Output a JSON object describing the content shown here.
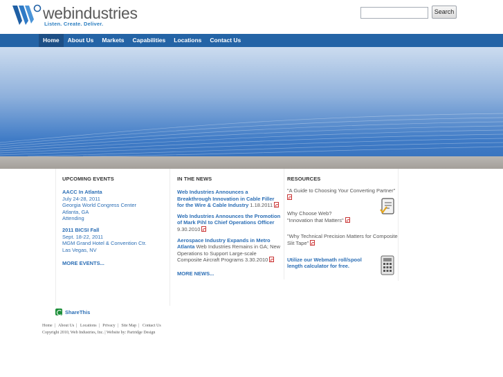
{
  "brand": {
    "name": "webindustries",
    "tagline": "Listen. Create. Deliver.",
    "color_primary": "#2464a6",
    "color_link": "#2b6eb5"
  },
  "search": {
    "value": "",
    "placeholder": "",
    "button_label": "Search"
  },
  "nav": {
    "items": [
      {
        "label": "Home",
        "active": true
      },
      {
        "label": "About Us"
      },
      {
        "label": "Markets"
      },
      {
        "label": "Capabilities"
      },
      {
        "label": "Locations"
      },
      {
        "label": "Contact Us"
      }
    ]
  },
  "events": {
    "title": "UPCOMING EVENTS",
    "items": [
      {
        "name": "AACC In Atlanta",
        "date": "July 24-28, 2011",
        "venue": "Georgia World Congress Center",
        "city": "Atlanta, GA",
        "status": "Attending"
      },
      {
        "name": "2011 BICSI Fall",
        "date": "Sept. 18-22, 2011",
        "venue": "MGM Grand Hotel & Convention Ctr.",
        "city": "Las Vegas, NV"
      }
    ],
    "more_label": "MORE EVENTS..."
  },
  "news": {
    "title": "IN THE NEWS",
    "items": [
      {
        "headline": "Web Industries Announces a Breakthrough Innovation in Cable Filler for the Wire & Cable Industry",
        "desc": "",
        "date": "1.18.2011"
      },
      {
        "headline": "Web Industries Announces the Promotion of Mark Pihl to Chief Operations Officer",
        "desc": "",
        "date": "9.30.2010"
      },
      {
        "headline": "Aerospace Industry Expands in Metro Atlanta",
        "desc": "Web Industries Remains in GA; New Operations to Support Large-scale Composite Aircraft Programs",
        "date": "3.30.2010"
      }
    ],
    "more_label": "MORE NEWS..."
  },
  "resources": {
    "title": "RESOURCES",
    "guide": "\"A Guide to Choosing Your Converting Partner\"",
    "why_choose": "Why Choose Web?",
    "innovation": "\"Innovation that Matters\"",
    "composite": "\"Why Technical Precision Matters for Composite Slit Tape\"",
    "calculator": "Utilize our Webmath roll/spool length calculator for free."
  },
  "share": {
    "label": "ShareThis"
  },
  "footer": {
    "links": [
      "Home",
      "About Us",
      "Locations",
      "Privacy",
      "Site Map",
      "Contact Us"
    ],
    "copyright": "Copyright 2010, Web Industries, Inc. | Website by: Partridge Design"
  }
}
